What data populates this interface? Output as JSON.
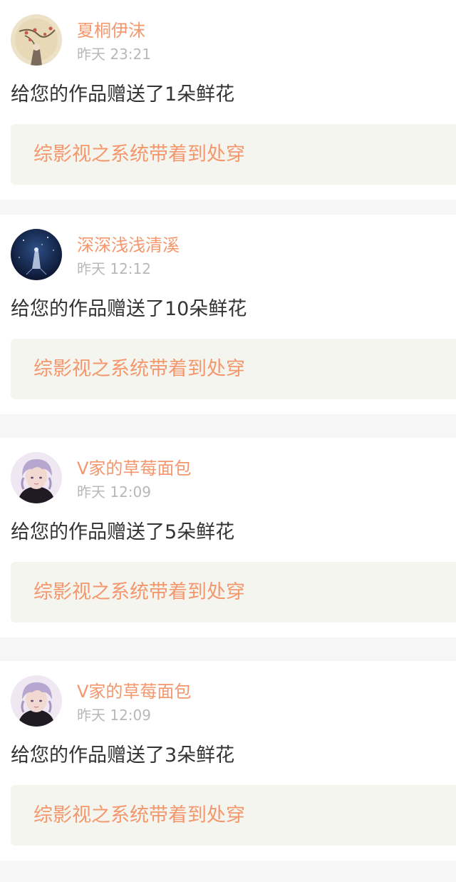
{
  "gifts": [
    {
      "avatar_icon": "girl-with-branch-avatar-icon",
      "username": "夏桐伊沫",
      "time": "昨天 23:21",
      "message": "给您的作品赠送了1朵鲜花",
      "work_title": "综影视之系统带着到处穿"
    },
    {
      "avatar_icon": "night-sky-figure-avatar-icon",
      "username": "深深浅浅清溪",
      "time": "昨天 12:12",
      "message": "给您的作品赠送了10朵鲜花",
      "work_title": "综影视之系统带着到处穿"
    },
    {
      "avatar_icon": "purple-hair-boy-avatar-icon",
      "username": "V家的草莓面包",
      "time": "昨天 12:09",
      "message": "给您的作品赠送了5朵鲜花",
      "work_title": "综影视之系统带着到处穿"
    },
    {
      "avatar_icon": "purple-hair-boy-avatar-icon",
      "username": "V家的草莓面包",
      "time": "昨天 12:09",
      "message": "给您的作品赠送了3朵鲜花",
      "work_title": "综影视之系统带着到处穿"
    }
  ],
  "colors": {
    "accent": "#f4976c",
    "text": "#333333",
    "muted": "#b8b8b8",
    "page_bg": "#f6f6f6",
    "card_bg": "#ffffff",
    "link_bg": "#f5f5f0"
  }
}
